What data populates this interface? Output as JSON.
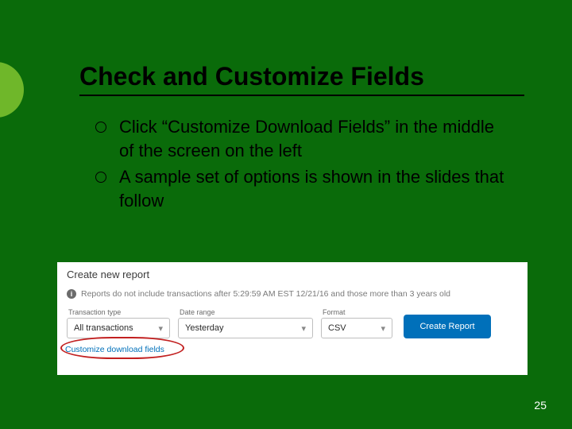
{
  "title": "Check and Customize Fields",
  "bullets": [
    "Click “Customize Download Fields” in the middle of the screen on the left",
    "A sample set of options is shown in the slides that follow"
  ],
  "panel": {
    "heading": "Create new report",
    "info_text": "Reports do not include transactions after 5:29:59 AM EST 12/21/16 and those more than 3 years old",
    "transaction": {
      "label": "Transaction type",
      "value": "All transactions"
    },
    "date": {
      "label": "Date range",
      "value": "Yesterday"
    },
    "format": {
      "label": "Format",
      "value": "CSV"
    },
    "create_label": "Create Report",
    "customize_link": "Customize download fields"
  },
  "page_number": "25"
}
